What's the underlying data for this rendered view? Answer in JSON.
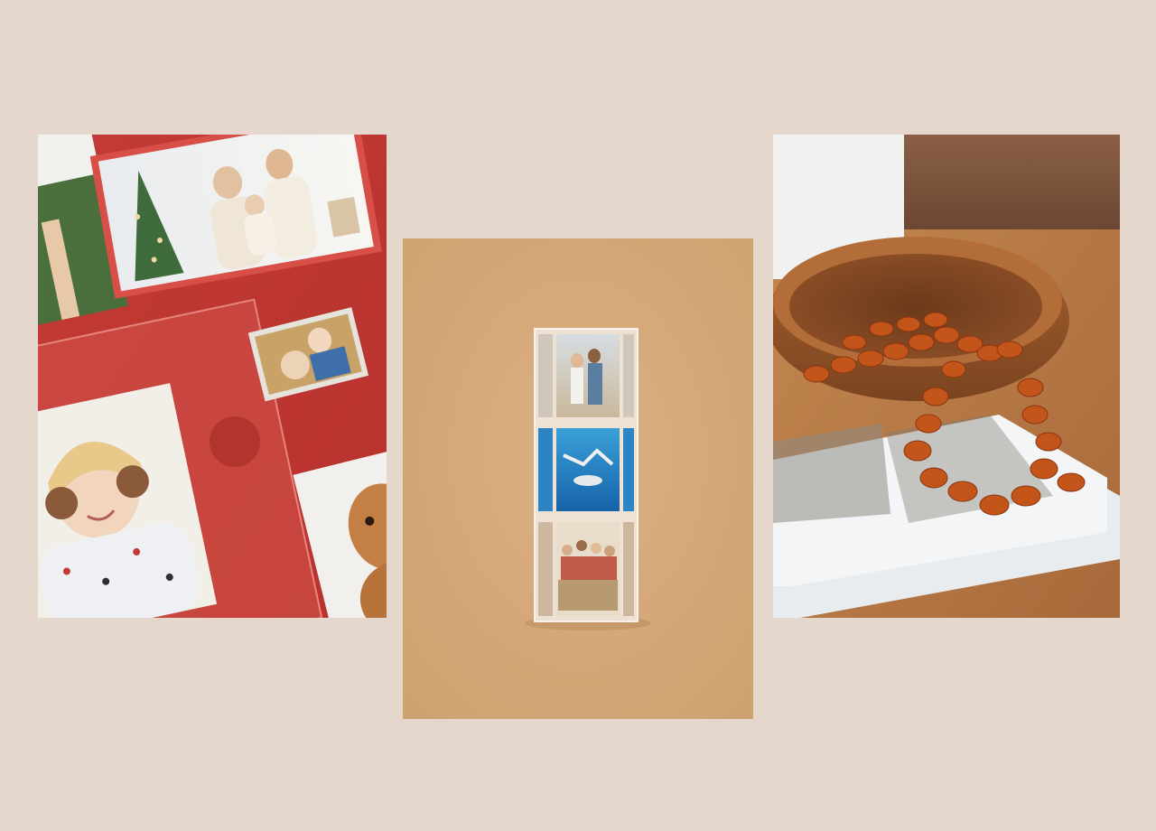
{
  "page": {
    "background": "#e6d7cc"
  },
  "photos": [
    {
      "id": "photo-1",
      "subject": "red-acrylic-photo-frames",
      "colors": {
        "base": "#c9403a",
        "frame": "#d9554c"
      }
    },
    {
      "id": "photo-2",
      "subject": "acrylic-photo-block-tower",
      "colors": {
        "base": "#d7a977",
        "acrylic": "#f2e9df"
      }
    },
    {
      "id": "photo-3",
      "subject": "wooden-bowl-with-amber-beads",
      "colors": {
        "table": "#b77a45",
        "bowl": "#9b5a2c",
        "amber": "#c4551a"
      }
    }
  ]
}
